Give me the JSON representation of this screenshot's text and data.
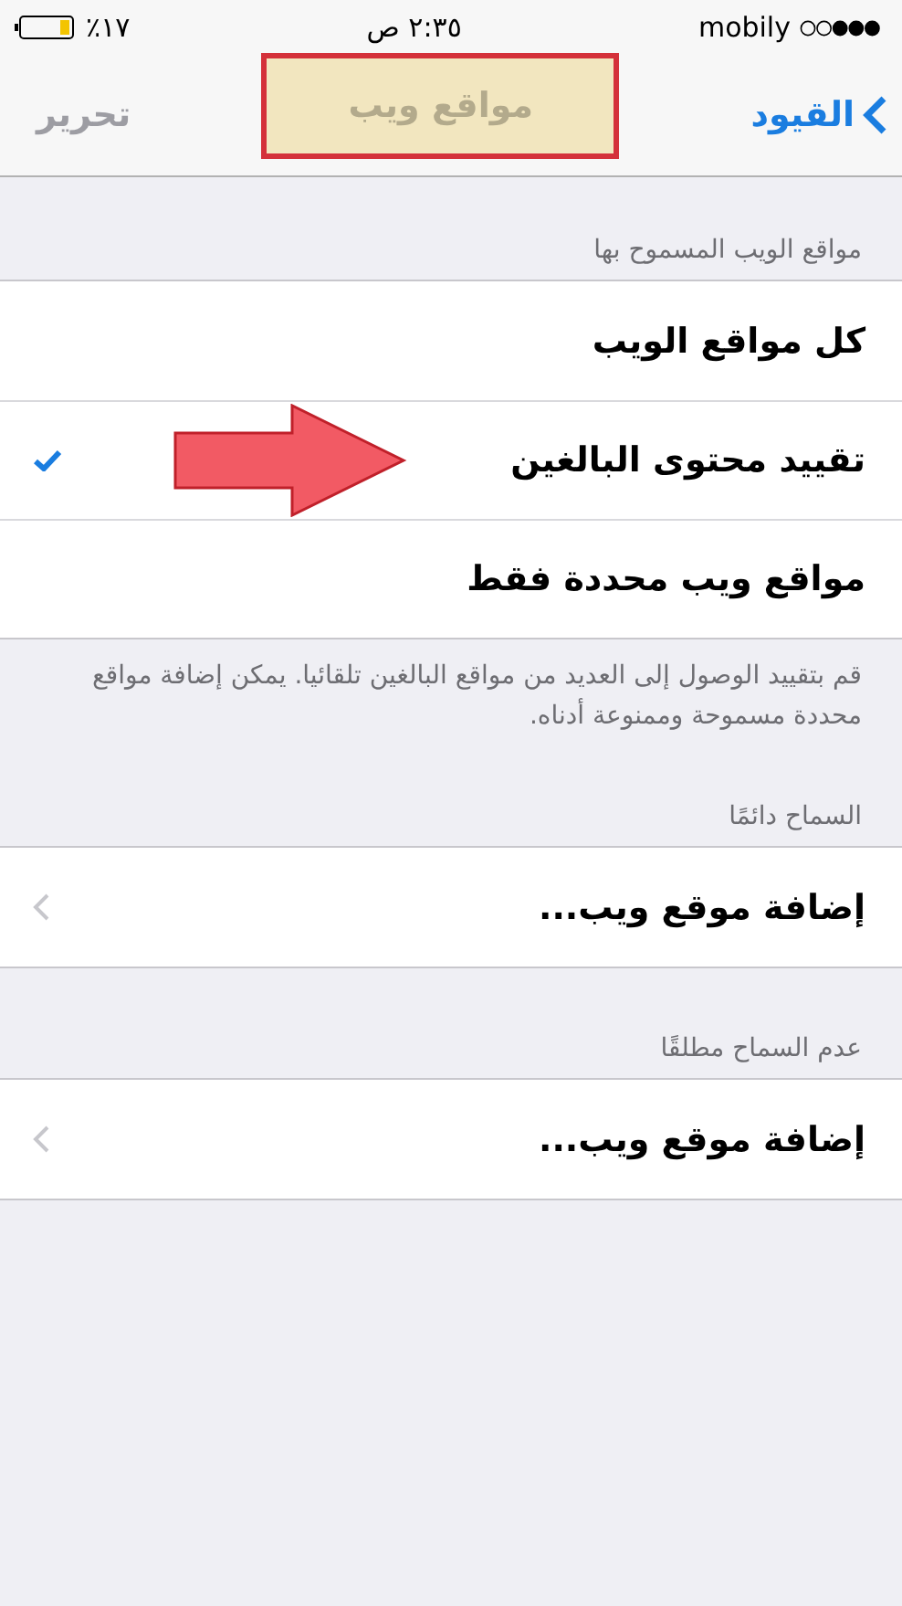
{
  "status_bar": {
    "carrier": "mobily",
    "time": "٢:٣٥ ص",
    "battery": "٪١٧"
  },
  "nav": {
    "back": "القيود",
    "title": "مواقع ويب",
    "title_highlighted": true,
    "action": "تحرير",
    "action_disabled": true
  },
  "sections": [
    {
      "header": "مواقع الويب المسموح بها",
      "footer": "قم بتقييد الوصول إلى العديد من مواقع البالغين تلقائيا. يمكن إضافة مواقع محددة مسموحة وممنوعة أدناه.",
      "rows": [
        {
          "kind": "option",
          "label": "كل مواقع الويب",
          "selected": false,
          "pointed": false
        },
        {
          "kind": "option",
          "label": "تقييد محتوى البالغين",
          "selected": true,
          "pointed": true
        },
        {
          "kind": "option",
          "label": "مواقع ويب محددة فقط",
          "selected": false,
          "pointed": false
        }
      ]
    },
    {
      "header": "السماح دائمًا",
      "rows": [
        {
          "kind": "link",
          "label": "إضافة موقع ويب..."
        }
      ]
    },
    {
      "header": "عدم السماح مطلقًا",
      "rows": [
        {
          "kind": "link",
          "label": "إضافة موقع ويب..."
        }
      ]
    }
  ]
}
